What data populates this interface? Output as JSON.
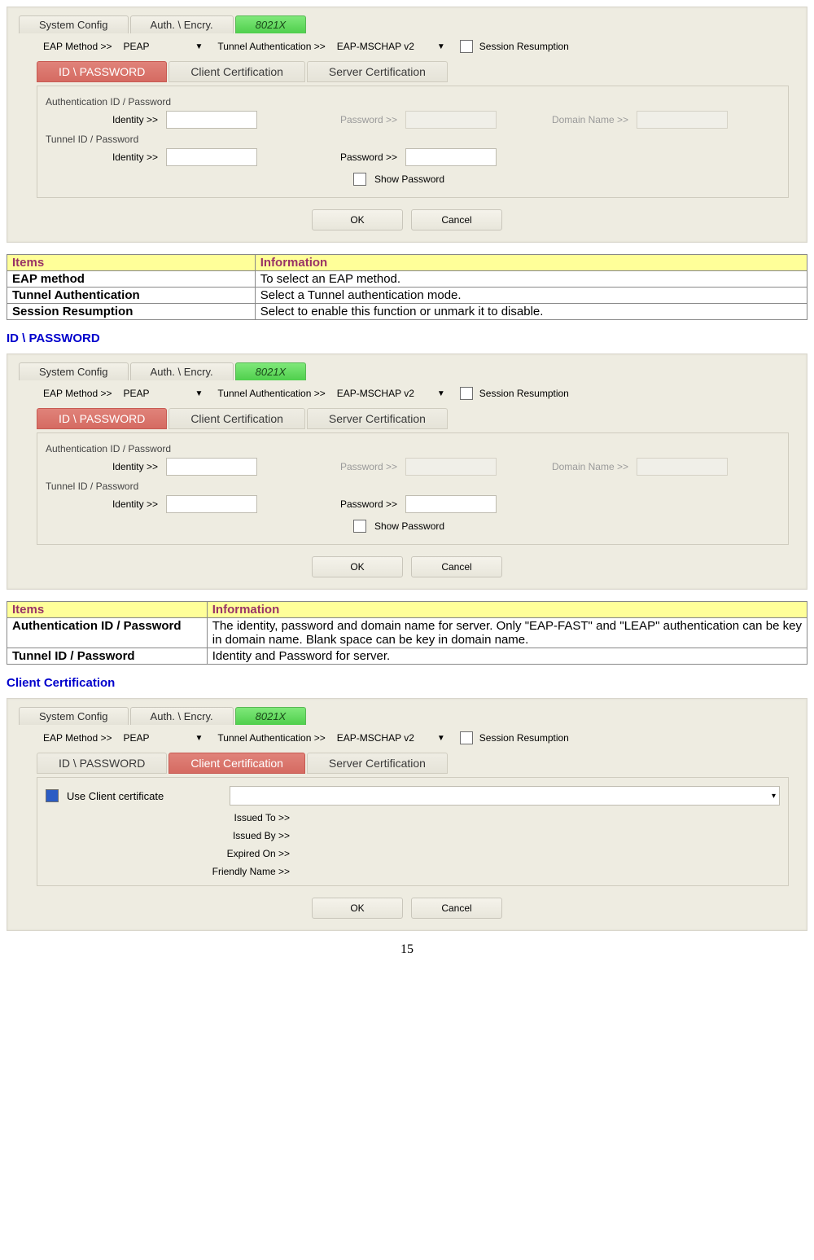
{
  "tabs": {
    "t1": "System Config",
    "t2": "Auth. \\ Encry.",
    "t3": "8021X"
  },
  "opt": {
    "eap_lbl": "EAP Method >>",
    "eap_val": "PEAP",
    "tun_lbl": "Tunnel Authentication >>",
    "tun_val": "EAP-MSCHAP v2",
    "session": "Session Resumption"
  },
  "subtabs": {
    "idpw": "ID \\ PASSWORD",
    "client": "Client Certification",
    "server": "Server Certification"
  },
  "form": {
    "auth_group": "Authentication ID / Password",
    "tun_group": "Tunnel ID / Password",
    "identity": "Identity >>",
    "password": "Password >>",
    "domain": "Domain Name >>",
    "showpwd": "Show Password"
  },
  "buttons": {
    "ok": "OK",
    "cancel": "Cancel"
  },
  "cert": {
    "use": "Use Client certificate",
    "issued_to": "Issued To >>",
    "issued_by": "Issued By >>",
    "expired_on": "Expired On >>",
    "friendly": "Friendly Name >>"
  },
  "table1": {
    "h1": "Items",
    "h2": "Information",
    "r1a": "EAP method",
    "r1b": "To select an EAP method.",
    "r2a": "Tunnel Authentication",
    "r2b": "Select a Tunnel authentication mode.",
    "r3a": "Session Resumption",
    "r3b": "Select to enable this function or unmark it to disable."
  },
  "heading_idpw": "ID \\ PASSWORD",
  "table2": {
    "h1": "Items",
    "h2": "Information",
    "r1a": "Authentication ID / Password",
    "r1b": "The identity, password and domain name for server. Only \"EAP-FAST\" and \"LEAP\" authentication can be key in domain name. Blank space can be key in domain name.",
    "r2a": "Tunnel ID / Password",
    "r2b": "Identity and Password for server."
  },
  "heading_client": "Client Certification",
  "page_num": "15"
}
